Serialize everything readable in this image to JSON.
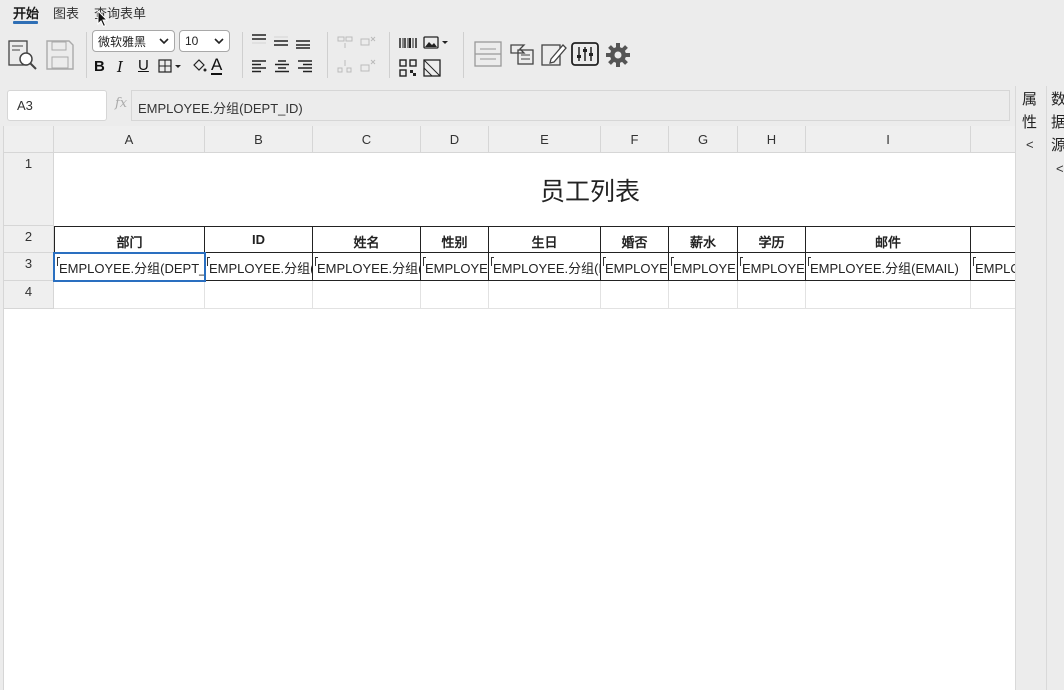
{
  "menu": {
    "tabs": [
      {
        "label": "开始",
        "active": true
      },
      {
        "label": "图表",
        "active": false
      },
      {
        "label": "查询表单",
        "active": false
      }
    ]
  },
  "toolbar": {
    "font_family": "微软雅黑",
    "font_size": "10",
    "bold": "B",
    "italic": "I",
    "underline": "U",
    "font_color": "A",
    "icons": [
      "preview-icon",
      "save-icon",
      "border-icon",
      "fill-color-icon",
      "align-top-icon",
      "align-middle-icon",
      "align-bottom-icon",
      "align-left-icon",
      "align-center-icon",
      "align-right-icon",
      "merge-cells-icon",
      "unmerge-cells-icon",
      "insert-row-icon",
      "delete-row-icon",
      "barcode-icon",
      "image-icon",
      "qrcode-icon",
      "slash-cell-icon",
      "page-break-icon",
      "dataset-icon",
      "edit-icon",
      "sliders-icon",
      "settings-icon"
    ]
  },
  "formula_bar": {
    "cell_ref": "A3",
    "fx_label": "fx",
    "formula": "EMPLOYEE.分组(DEPT_ID)"
  },
  "side_panels": {
    "properties": {
      "label": "属性",
      "arrow": "<"
    },
    "datasource": {
      "label": "数据源",
      "arrow": "<"
    }
  },
  "grid": {
    "columns": [
      "A",
      "B",
      "C",
      "D",
      "E",
      "F",
      "G",
      "H",
      "I",
      ""
    ],
    "rows": [
      "1",
      "2",
      "3",
      "4"
    ],
    "title": "员工列表",
    "headers": [
      "部门",
      "ID",
      "姓名",
      "性别",
      "生日",
      "婚否",
      "薪水",
      "学历",
      "邮件",
      ""
    ],
    "data_row": [
      "EMPLOYEE.分组(DEPT_ID)",
      "EMPLOYEE.分组(ID)",
      "EMPLOYEE.分组(NAME)",
      "EMPLOYEE.分组(SEX)",
      "EMPLOYEE.分组(BIRTHDAY)",
      "EMPLOYEE.分组(MARRIED)",
      "EMPLOYEE.分组(SALARY)",
      "EMPLOYEE.分组(DEGREE)",
      "EMPLOYEE.分组(EMAIL)",
      "EMPLOYEE.分组(PHONE)"
    ],
    "selected_cell": "A3"
  },
  "colors": {
    "accent": "#2f6fb5",
    "selection": "#2a6fc0",
    "header_bg": "#efefef"
  }
}
